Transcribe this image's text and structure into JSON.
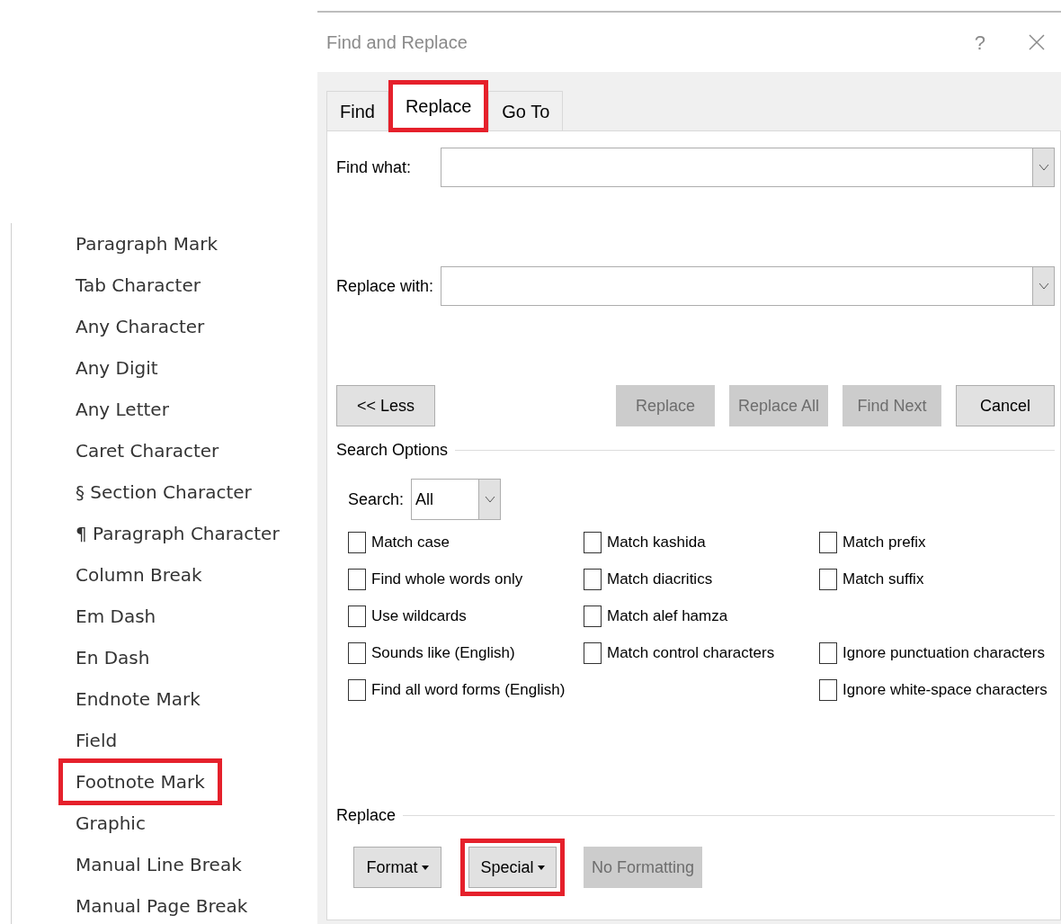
{
  "special_menu": {
    "items": [
      {
        "label": "Paragraph Mark",
        "highlighted": false
      },
      {
        "label": "Tab Character",
        "highlighted": false
      },
      {
        "label": "Any Character",
        "highlighted": false
      },
      {
        "label": "Any Digit",
        "highlighted": false
      },
      {
        "label": "Any Letter",
        "highlighted": false
      },
      {
        "label": "Caret Character",
        "highlighted": false
      },
      {
        "label": "§ Section Character",
        "highlighted": false
      },
      {
        "label": "¶ Paragraph Character",
        "highlighted": false
      },
      {
        "label": "Column Break",
        "highlighted": false
      },
      {
        "label": "Em Dash",
        "highlighted": false
      },
      {
        "label": "En Dash",
        "highlighted": false
      },
      {
        "label": "Endnote Mark",
        "highlighted": false
      },
      {
        "label": "Field",
        "highlighted": false
      },
      {
        "label": "Footnote Mark",
        "highlighted": true
      },
      {
        "label": "Graphic",
        "highlighted": false
      },
      {
        "label": "Manual Line Break",
        "highlighted": false
      },
      {
        "label": "Manual Page Break",
        "highlighted": false
      }
    ]
  },
  "window": {
    "title": "Find and Replace",
    "help": "?"
  },
  "tabs": [
    {
      "label": "Find",
      "selected": false,
      "highlighted": false
    },
    {
      "label": "Replace",
      "selected": true,
      "highlighted": true
    },
    {
      "label": "Go To",
      "selected": false,
      "highlighted": false
    }
  ],
  "find_what": {
    "label": "Find what:"
  },
  "replace_with": {
    "label": "Replace with:"
  },
  "action_buttons": [
    {
      "label": "<< Less",
      "disabled": false
    },
    {
      "label": "Replace",
      "disabled": true
    },
    {
      "label": "Replace All",
      "disabled": true
    },
    {
      "label": "Find Next",
      "disabled": true
    },
    {
      "label": "Cancel",
      "disabled": false
    }
  ],
  "search_options": {
    "title": "Search Options",
    "search_label": "Search:",
    "search_value": "All",
    "rows": [
      {
        "col_1": {
          "label": "Match case",
          "checked": false
        },
        "col_2": {
          "label": "Match kashida",
          "checked": false
        },
        "col_3": {
          "label": "Match prefix",
          "checked": false
        }
      },
      {
        "col_1": {
          "label": "Find whole words only",
          "checked": false
        },
        "col_2": {
          "label": "Match diacritics",
          "checked": false
        },
        "col_3": {
          "label": "Match suffix",
          "checked": false
        }
      },
      {
        "col_1": {
          "label": "Use wildcards",
          "checked": false
        },
        "col_2": {
          "label": "Match alef hamza",
          "checked": false
        }
      },
      {
        "col_1": {
          "label": "Sounds like (English)",
          "checked": false
        },
        "col_2": {
          "label": "Match control characters",
          "checked": false
        },
        "col_3": {
          "label": "Ignore punctuation characters",
          "checked": false
        }
      },
      {
        "col_1": {
          "label": "Find all word forms (English)",
          "checked": false
        },
        "col_3": {
          "label": "Ignore white-space characters",
          "checked": false
        }
      }
    ]
  },
  "replace_section": {
    "title": "Replace",
    "buttons": [
      {
        "label": "Format",
        "disabled": false,
        "highlighted": false
      },
      {
        "label": "Special",
        "disabled": false,
        "highlighted": true
      },
      {
        "label": "No Formatting",
        "disabled": true,
        "highlighted": false
      }
    ]
  }
}
